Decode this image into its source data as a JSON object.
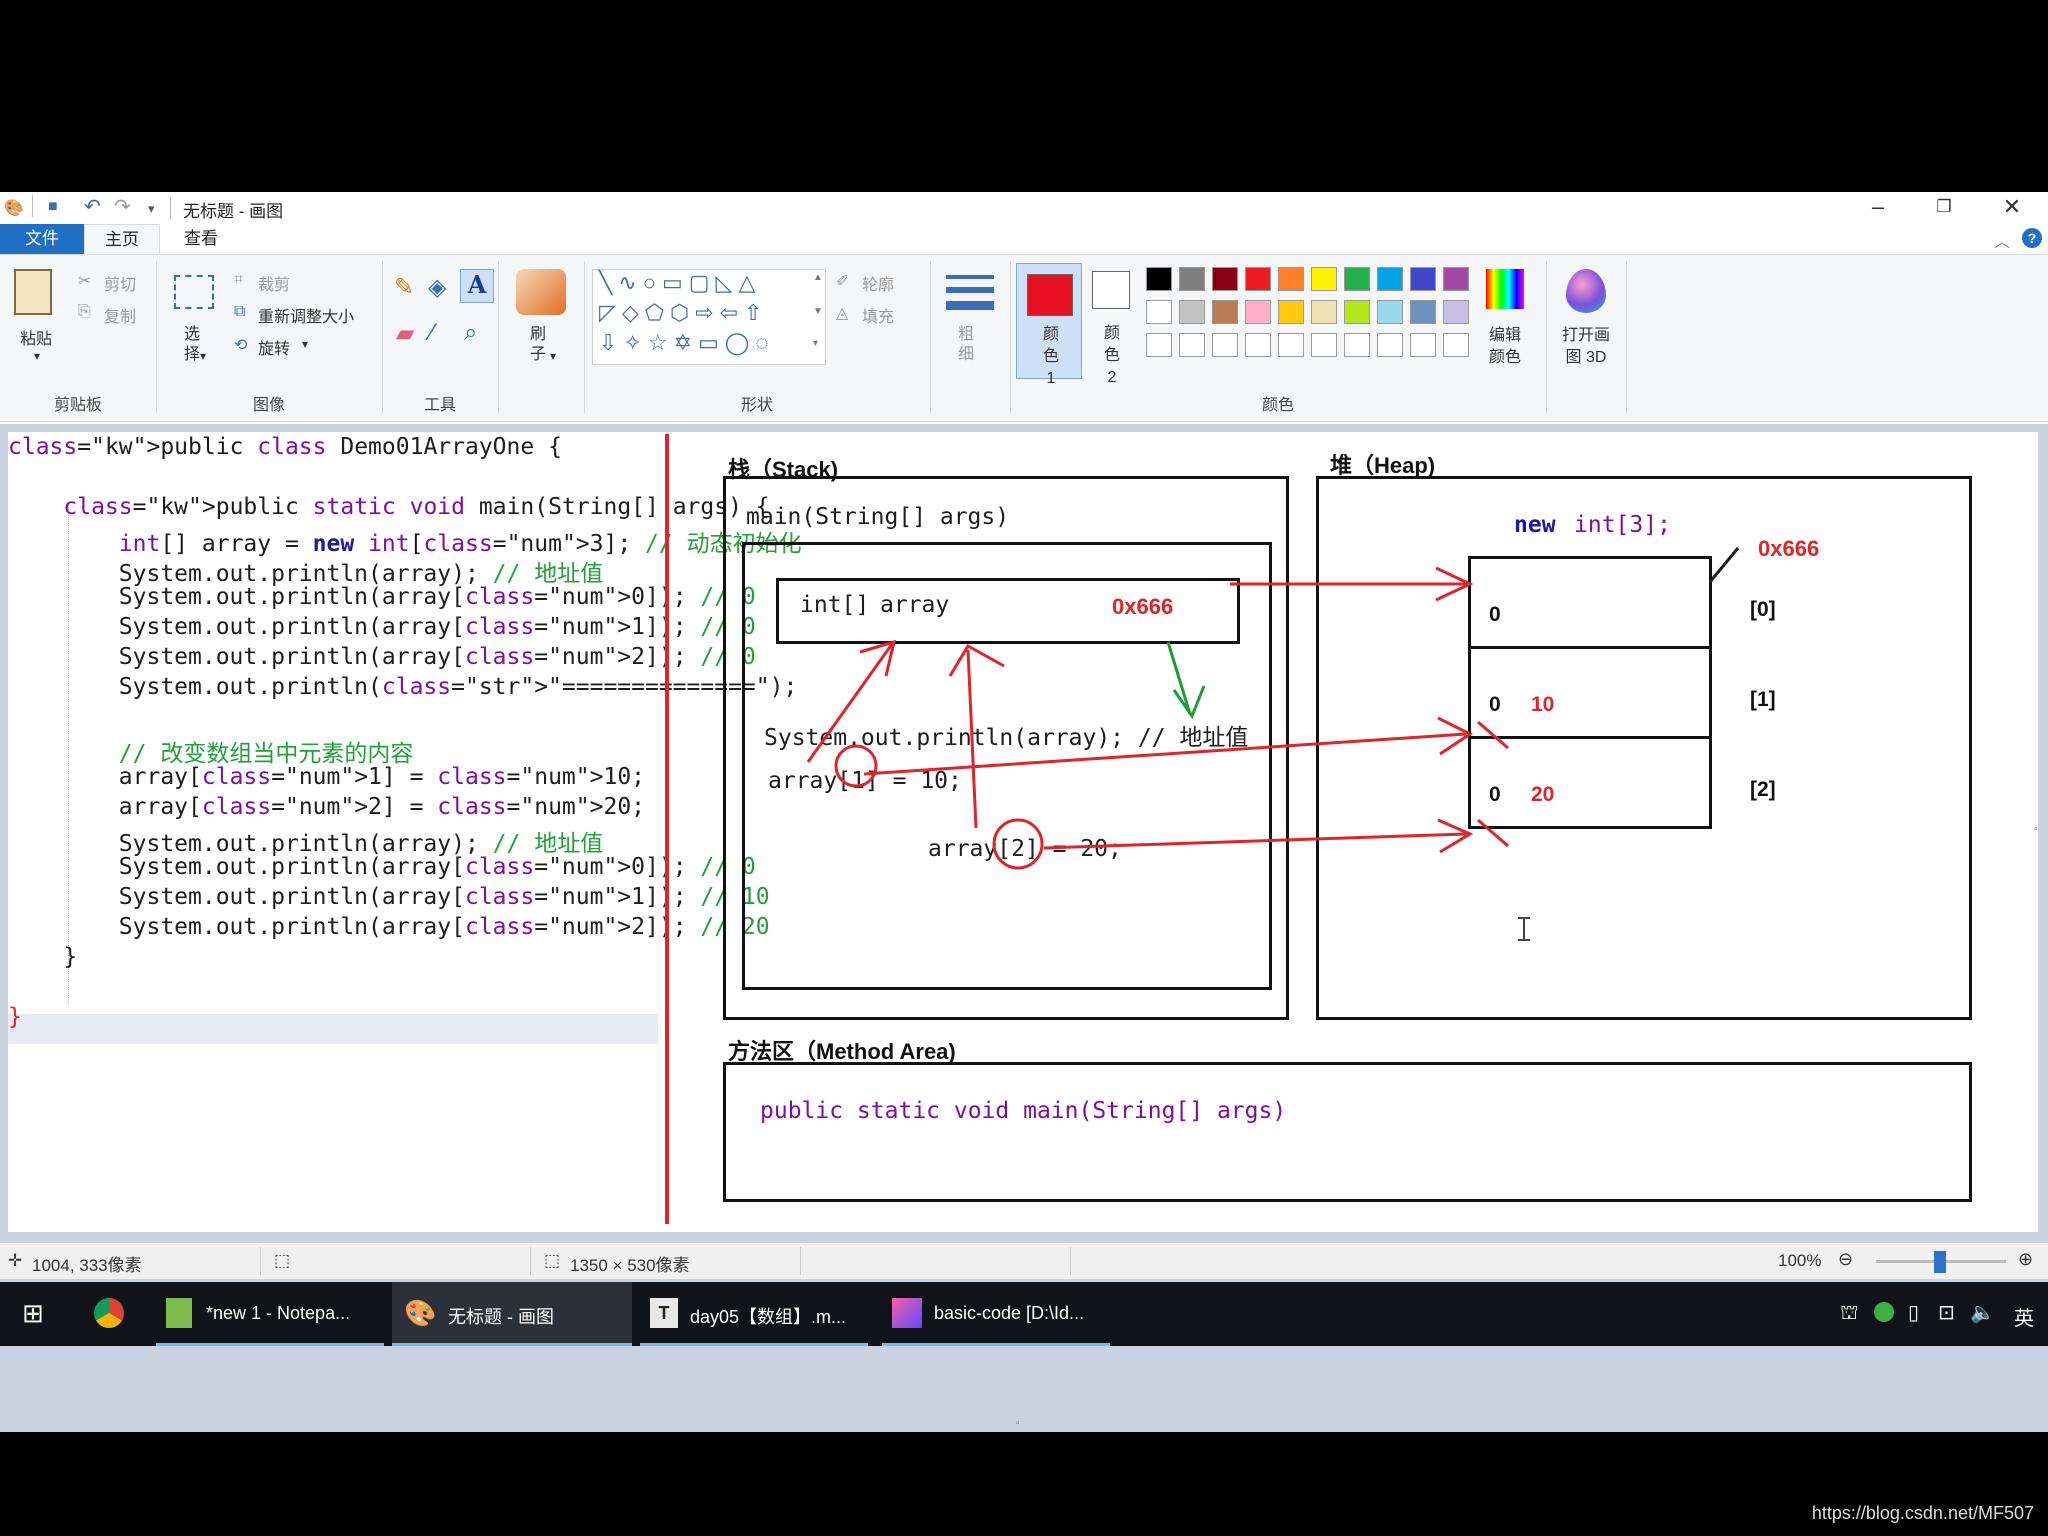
{
  "app": {
    "title": "无标题 - 画图"
  },
  "ribbon": {
    "tabs": {
      "file": "文件",
      "home": "主页",
      "view": "查看"
    },
    "clipboard": {
      "label": "剪贴板",
      "paste": "粘贴",
      "cut": "剪切",
      "copy": "复制"
    },
    "image": {
      "label": "图像",
      "select": "选择",
      "crop": "裁剪",
      "resize": "重新调整大小",
      "rotate": "旋转"
    },
    "tools": {
      "label": "工具"
    },
    "brush": {
      "label": "刷子"
    },
    "shapes": {
      "label": "形状",
      "outline": "轮廓",
      "fill": "填充"
    },
    "size": {
      "label": "粗细"
    },
    "colors": {
      "label": "颜色",
      "color1": "颜色 1",
      "color2": "颜色 2",
      "edit": "编辑颜色",
      "color1_value": "#e81123",
      "color2_value": "#ffffff",
      "palette_row1": [
        "#000000",
        "#7f7f7f",
        "#880015",
        "#ed1c24",
        "#ff7f27",
        "#fff200",
        "#22b14c",
        "#00a2e8",
        "#3f48cc",
        "#a349a4"
      ],
      "palette_row2": [
        "#ffffff",
        "#c3c3c3",
        "#b97a57",
        "#ffaec9",
        "#ffc90e",
        "#efe4b0",
        "#b5e61d",
        "#99d9ea",
        "#7092be",
        "#c8bfe7"
      ]
    },
    "paint3d": "打开画图 3D"
  },
  "code": {
    "lines": [
      "public class Demo01ArrayOne {",
      "",
      "    public static void main(String[] args) {",
      "        int[] array = new int[3]; // 动态初始化",
      "        System.out.println(array); // 地址值",
      "        System.out.println(array[0]); // 0",
      "        System.out.println(array[1]); // 0",
      "        System.out.println(array[2]); // 0",
      "        System.out.println(\"==============\");",
      "",
      "        // 改变数组当中元素的内容",
      "        array[1] = 10;",
      "        array[2] = 20;",
      "        System.out.println(array); // 地址值",
      "        System.out.println(array[0]); // 0",
      "        System.out.println(array[1]); // 10",
      "        System.out.println(array[2]); // 20",
      "    }",
      "",
      "}"
    ]
  },
  "diagram": {
    "stack_title": "栈（Stack)",
    "heap_title": "堆（Heap)",
    "method_title": "方法区（Method Area)",
    "frame_label": "main(String[] args)",
    "var_label_type": "int[]",
    "var_label_name": "array",
    "var_address": "0x666",
    "println_stmt": "System.out.println(array); // 地址值",
    "assign1": "array[1] = 10;",
    "assign2": "array[2] = 20;",
    "heap_new_kw": "new",
    "heap_new_type": "int[3];",
    "heap_address": "0x666",
    "cells": [
      {
        "old": "0",
        "new": "",
        "index": "[0]"
      },
      {
        "old": "0",
        "new": "10",
        "index": "[1]"
      },
      {
        "old": "0",
        "new": "20",
        "index": "[2]"
      }
    ],
    "method_sig": "public static void main(String[] args)"
  },
  "status": {
    "cursor_pos": "1004, 333像素",
    "canvas_size": "1350 × 530像素",
    "zoom": "100%"
  },
  "taskbar": {
    "items": [
      {
        "label": "*new 1 - Notepa..."
      },
      {
        "label": "无标题 - 画图"
      },
      {
        "label": "day05【数组】.m..."
      },
      {
        "label": "basic-code [D:\\Id..."
      }
    ],
    "ime": "英"
  },
  "watermark": "https://blog.csdn.net/MF507"
}
